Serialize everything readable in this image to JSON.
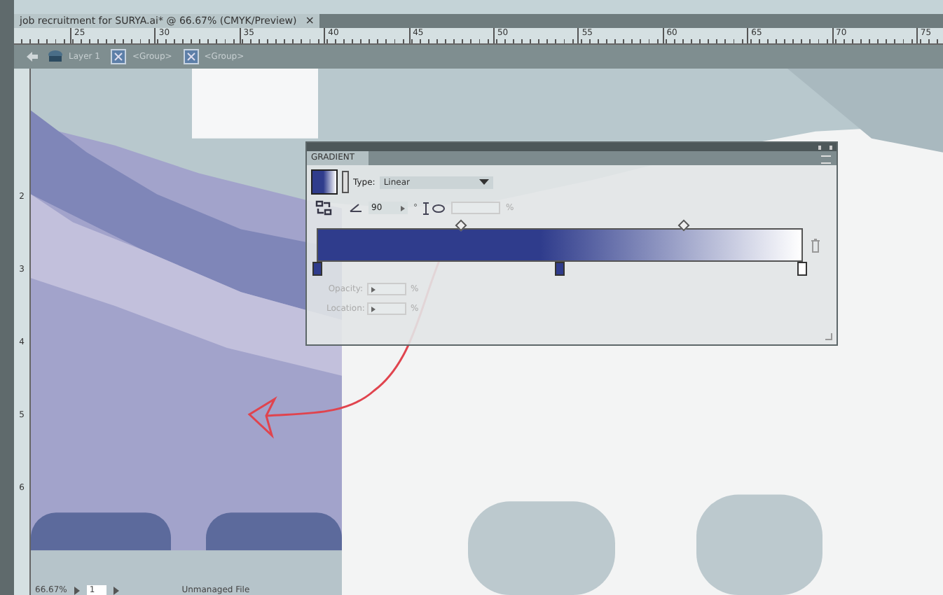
{
  "document_tab": {
    "title": "job recruitment for SURYA.ai* @ 66.67% (CMYK/Preview)",
    "close": "×"
  },
  "ruler": {
    "labels": [
      "25",
      "30",
      "35",
      "40",
      "45",
      "50",
      "55",
      "60",
      "65",
      "70",
      "75"
    ]
  },
  "vertical_ruler": {
    "labels": [
      "2",
      "3",
      "4",
      "5",
      "6"
    ]
  },
  "breadcrumb": [
    {
      "label": "Layer 1",
      "kind": "layer"
    },
    {
      "label": "<Group>",
      "kind": "group"
    },
    {
      "label": "<Group>",
      "kind": "group"
    }
  ],
  "gradient_panel": {
    "title": "GRADIENT",
    "type_label": "Type:",
    "type_value": "Linear",
    "angle": "90",
    "degree": "°",
    "aspect_unit": "%",
    "stops": [
      {
        "color": "#2f3c8c"
      },
      {
        "color": "#2f3c8c"
      },
      {
        "color": "#ffffff"
      }
    ],
    "opacity_label": "Opacity:",
    "opacity_unit": "%",
    "location_label": "Location:",
    "location_unit": "%"
  },
  "status_bar": {
    "zoom": "66.67%",
    "artboard": "1",
    "file_status": "Unmanaged File"
  }
}
